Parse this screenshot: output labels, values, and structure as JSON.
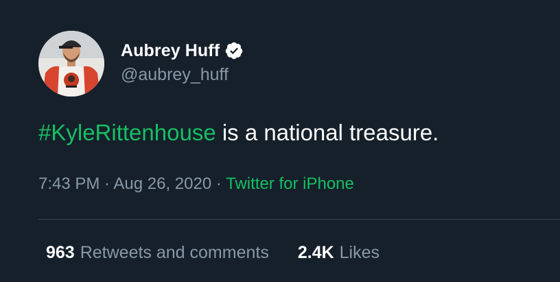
{
  "user": {
    "display_name": "Aubrey Huff",
    "handle": "@aubrey_huff",
    "verified_icon": "verified-badge-icon",
    "avatar_icon": "profile-photo-avatar"
  },
  "tweet": {
    "hashtag": "#KyleRittenhouse",
    "text_rest": " is a national treasure."
  },
  "meta": {
    "time": "7:43 PM",
    "separator1": " · ",
    "date": "Aug 26, 2020",
    "separator2": " · ",
    "source": "Twitter for iPhone"
  },
  "stats": {
    "retweets_count": "963",
    "retweets_label": "Retweets and comments",
    "likes_count": "2.4K",
    "likes_label": "Likes"
  },
  "colors": {
    "background": "#15202b",
    "accent": "#17bf63",
    "secondary_text": "#8899a6",
    "divider": "#38444d"
  }
}
